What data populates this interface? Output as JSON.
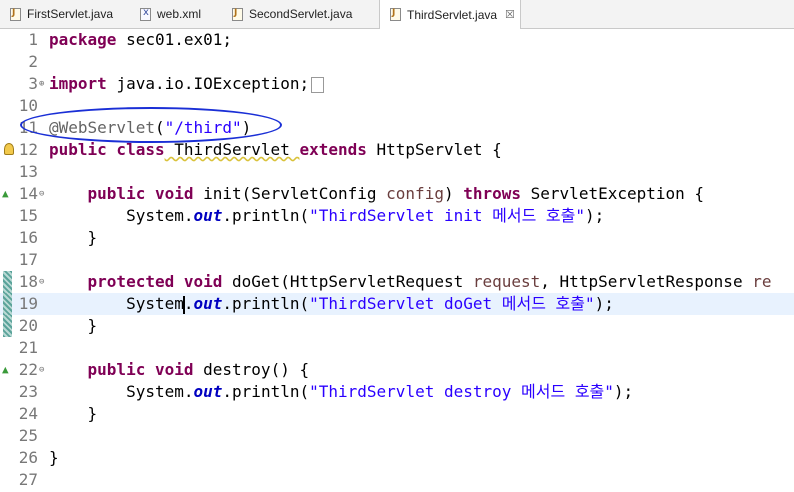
{
  "tabs": [
    {
      "label": "FirstServlet.java",
      "icon": "java-file-icon",
      "active": false
    },
    {
      "label": "web.xml",
      "icon": "xml-file-icon",
      "active": false
    },
    {
      "label": "SecondServlet.java",
      "icon": "java-file-icon",
      "active": false
    },
    {
      "label": "ThirdServlet.java",
      "icon": "java-file-icon",
      "active": true,
      "close": "☒"
    }
  ],
  "lines": [
    {
      "n": "1",
      "tokens": [
        [
          "kw",
          "package"
        ],
        [
          "",
          "sec01.ex01;"
        ]
      ]
    },
    {
      "n": "2",
      "tokens": []
    },
    {
      "n": "3",
      "tokens": [
        [
          "kw",
          "import"
        ],
        [
          "",
          "java.io.IOException;"
        ]
      ]
    },
    {
      "n": "10",
      "tokens": []
    },
    {
      "n": "11",
      "tokens": [
        [
          "ann",
          "@WebServlet"
        ],
        [
          "",
          "("
        ],
        [
          "str",
          "\"/third\""
        ],
        [
          "",
          ")"
        ]
      ]
    },
    {
      "n": "12",
      "tokens": [
        [
          "kw",
          "public class"
        ],
        [
          "",
          " ThirdServlet "
        ],
        [
          "kw",
          "extends"
        ],
        [
          "",
          " HttpServlet {"
        ]
      ]
    },
    {
      "n": "13",
      "tokens": []
    },
    {
      "n": "14",
      "tokens": [
        [
          "kw",
          "public void"
        ],
        [
          "",
          " init(ServletConfig "
        ],
        [
          "prm",
          "config"
        ],
        [
          "",
          ") "
        ],
        [
          "kw",
          "throws"
        ],
        [
          "",
          " ServletException {"
        ]
      ]
    },
    {
      "n": "15",
      "tokens": [
        [
          "",
          "System."
        ],
        [
          "fld",
          "out"
        ],
        [
          "",
          ".println("
        ],
        [
          "str",
          "\"ThirdServlet init 메서드 호출\""
        ],
        [
          "",
          ");"
        ]
      ]
    },
    {
      "n": "16",
      "tokens": [
        [
          "",
          "}"
        ]
      ]
    },
    {
      "n": "17",
      "tokens": []
    },
    {
      "n": "18",
      "tokens": [
        [
          "kw",
          "protected void"
        ],
        [
          "",
          " doGet(HttpServletRequest "
        ],
        [
          "prm",
          "request"
        ],
        [
          "",
          ", HttpServletResponse "
        ],
        [
          "prm",
          "re"
        ]
      ]
    },
    {
      "n": "19",
      "tokens": [
        [
          "",
          "System"
        ],
        [
          "caret",
          ""
        ],
        [
          "",
          "."
        ],
        [
          "fld",
          "out"
        ],
        [
          "",
          ".println("
        ],
        [
          "str",
          "\"ThirdServlet doGet 메서드 호출\""
        ],
        [
          "",
          ");"
        ]
      ]
    },
    {
      "n": "20",
      "tokens": [
        [
          "",
          "}"
        ]
      ]
    },
    {
      "n": "21",
      "tokens": []
    },
    {
      "n": "22",
      "tokens": [
        [
          "kw",
          "public void"
        ],
        [
          "",
          " destroy() {"
        ]
      ]
    },
    {
      "n": "23",
      "tokens": [
        [
          "",
          "System."
        ],
        [
          "fld",
          "out"
        ],
        [
          "",
          ".println("
        ],
        [
          "str",
          "\"ThirdServlet destroy 메서드 호출\""
        ],
        [
          "",
          ");"
        ]
      ]
    },
    {
      "n": "24",
      "tokens": [
        [
          "",
          "}"
        ]
      ]
    },
    {
      "n": "25",
      "tokens": []
    },
    {
      "n": "26",
      "tokens": [
        [
          "",
          "}"
        ]
      ]
    },
    {
      "n": "27",
      "tokens": []
    }
  ]
}
